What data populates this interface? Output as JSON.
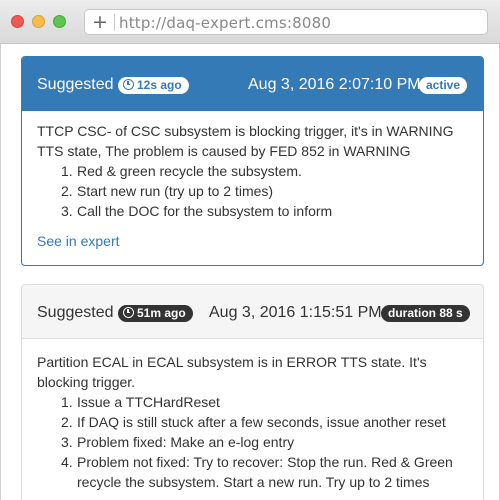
{
  "browser": {
    "url": "http://daq-expert.cms:8080"
  },
  "panels": [
    {
      "title": "Suggested",
      "time_badge": "12s ago",
      "date": "Aug 3, 2016 2:07:10 PM",
      "status_badge": "active",
      "description": "TTCP CSC- of CSC subsystem is blocking trigger, it's in WARNING TTS state, The problem is caused by FED 852 in WARNING",
      "steps": [
        {
          "num": "1.",
          "text": "Red & green recycle the subsystem."
        },
        {
          "num": "2.",
          "text": "Start new run (try up to 2 times)"
        },
        {
          "num": "3.",
          "text": "Call the DOC for the subsystem to inform"
        }
      ],
      "link": "See in expert"
    },
    {
      "title": "Suggested",
      "time_badge": "51m ago",
      "date": "Aug 3, 2016 1:15:51 PM",
      "status_badge": "duration 88 s",
      "description": "Partition ECAL in ECAL subsystem is in ERROR TTS state. It's blocking trigger.",
      "steps": [
        {
          "num": "1.",
          "text": "Issue a TTCHardReset"
        },
        {
          "num": "2.",
          "text": "If DAQ is still stuck after a few seconds, issue another reset"
        },
        {
          "num": "3.",
          "text": "Problem fixed: Make an e-log entry"
        },
        {
          "num": "4.",
          "text": "Problem not fixed: Try to recover: Stop the run. Red & Green recycle the subsystem. Start a new run. Try up to 2 times"
        }
      ]
    }
  ],
  "colors": {
    "primary": "#337ab7",
    "dark_badge": "#333333",
    "panel_default_heading": "#f5f5f5"
  },
  "icons": [
    "plus-icon",
    "clock-icon"
  ]
}
